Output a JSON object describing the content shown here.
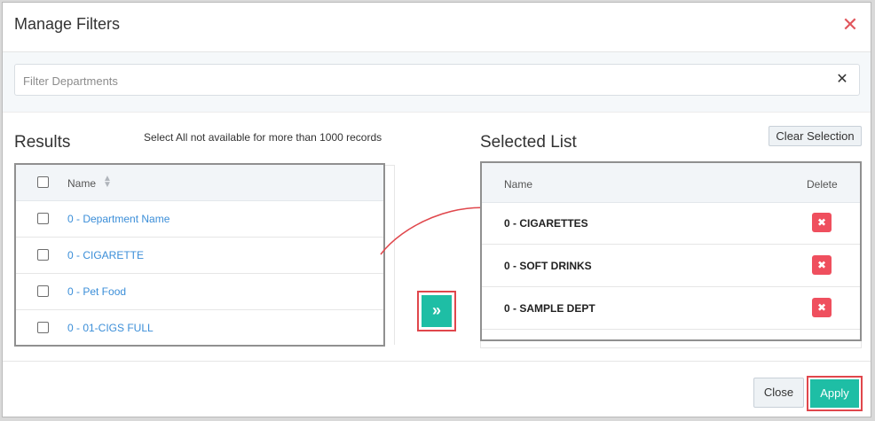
{
  "modal": {
    "title": "Manage Filters",
    "close_icon": "close-icon"
  },
  "search": {
    "placeholder": "Filter Departments",
    "value": "",
    "clear_icon": "clear-x-icon"
  },
  "results": {
    "heading": "Results",
    "note": "Select All not available for more than 1000 records",
    "column_name": "Name",
    "sort_icon": "sort-icon",
    "rows": [
      {
        "label": "0 - Department Name",
        "checked": false
      },
      {
        "label": "0 - CIGARETTE",
        "checked": false
      },
      {
        "label": "0 - Pet Food",
        "checked": false
      },
      {
        "label": "0 - 01-CIGS FULL",
        "checked": false
      }
    ]
  },
  "move_button": {
    "icon": "double-chevron-right-icon",
    "glyph": "»"
  },
  "selected": {
    "heading": "Selected List",
    "clear_label": "Clear Selection",
    "column_name": "Name",
    "column_delete": "Delete",
    "rows": [
      {
        "label": "0 - CIGARETTES"
      },
      {
        "label": "0 - SOFT DRINKS"
      },
      {
        "label": "0 - SAMPLE DEPT"
      }
    ]
  },
  "footer": {
    "close_label": "Close",
    "apply_label": "Apply"
  },
  "colors": {
    "accent": "#1ebea5",
    "delete": "#ef4f5e",
    "highlight": "#e0474c",
    "link": "#3b8ed8"
  }
}
